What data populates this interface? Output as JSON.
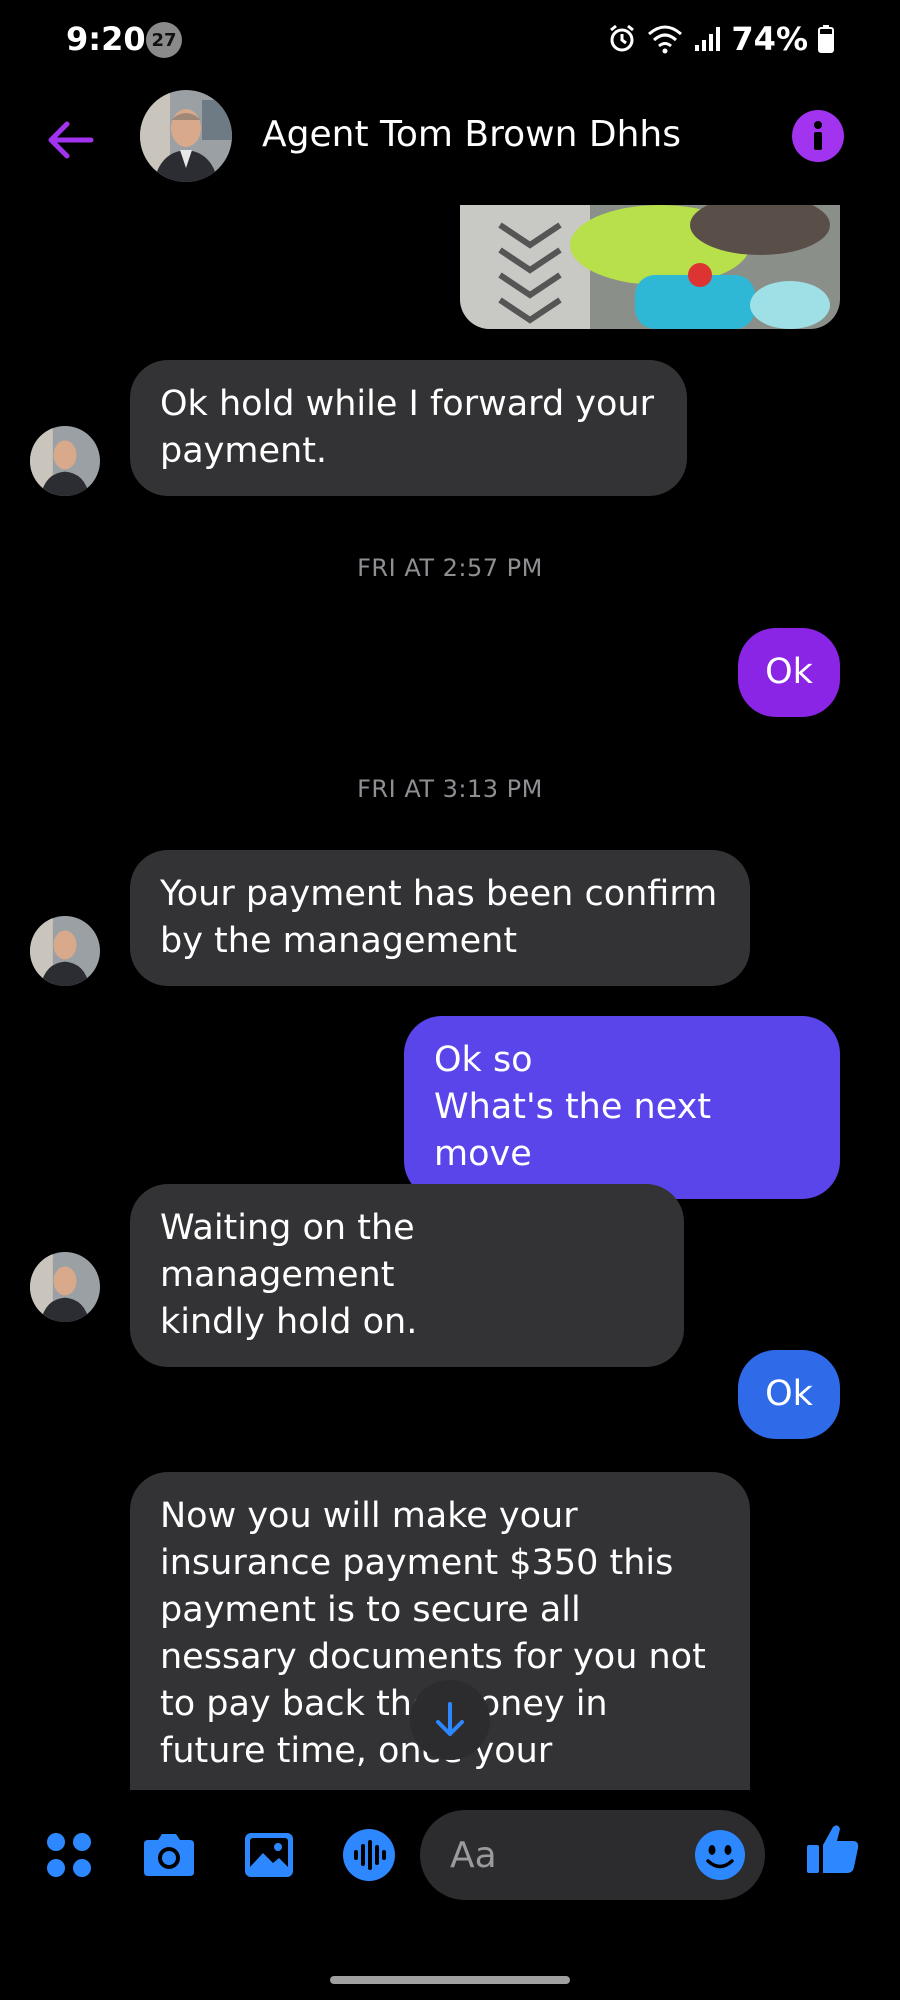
{
  "status_bar": {
    "time": "9:20",
    "notification_count": "27",
    "battery": "74%",
    "icons": [
      "alarm-icon",
      "wifi-icon",
      "signal-icon",
      "battery-icon"
    ]
  },
  "header": {
    "contact_name": "Agent Tom Brown Dhhs",
    "back_icon": "arrow-left-icon",
    "info_icon": "info-icon"
  },
  "colors": {
    "accent": "#a233ee",
    "incoming_bubble": "#333335",
    "outgoing_purple": "#8a25e6",
    "outgoing_indigo": "#5a45ea",
    "outgoing_blue": "#2f6ae8",
    "composer_blue": "#2d88ff"
  },
  "messages": {
    "m1": "Ok hold while I forward your\npayment.",
    "ts1": "FRI AT 2:57 PM",
    "m2": "Ok",
    "ts2": "FRI AT 3:13 PM",
    "m3": "Your payment has been confirm\nby the management",
    "m4": "Ok so\nWhat's the next move",
    "m5": "Waiting on the management\nkindly hold on.",
    "m6": "Ok",
    "m7": "Now you will make your\ninsurance payment $350 this\npayment is to secure all\nnessary documents for you not\nto pay back the money in\nfuture time, once your"
  },
  "composer": {
    "placeholder": "Aa",
    "icons": [
      "apps-icon",
      "camera-icon",
      "gallery-icon",
      "voice-icon",
      "emoji-icon",
      "thumbs-up-icon"
    ]
  }
}
